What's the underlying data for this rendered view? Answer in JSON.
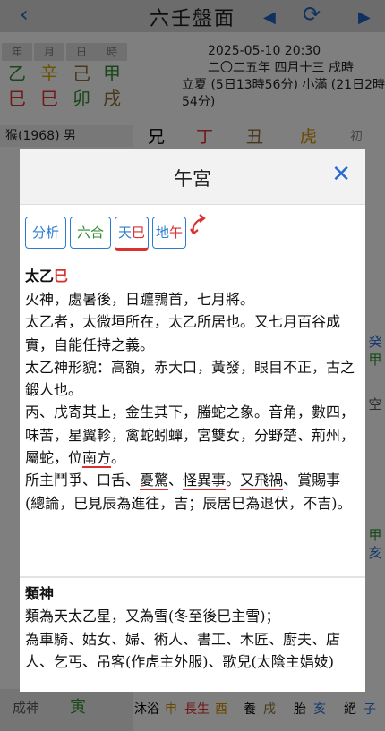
{
  "app": {
    "title": "六壬盤面"
  },
  "nav": {
    "back": "‹",
    "prev": "◀",
    "refresh": "⟳",
    "next": "▶"
  },
  "pillars": {
    "headers": [
      "年",
      "月",
      "日",
      "時"
    ],
    "stems": [
      "乙",
      "辛",
      "己",
      "甲"
    ],
    "branches": [
      "巳",
      "巳",
      "卯",
      "戌"
    ]
  },
  "date": {
    "datetime": "2025-05-10 20:30",
    "lunar": "二〇二五年 四月十三 戌時",
    "solar_terms": "立夏 (5日13時56分) 小滿 (21日2時54分)"
  },
  "person": {
    "info": "猴(1968) 男"
  },
  "top_row": [
    "兄",
    "丁",
    "丑",
    "虎",
    "初"
  ],
  "right_strip": [
    "癸",
    "甲",
    "空",
    "甲",
    "亥"
  ],
  "bottom_row": [
    "沐浴",
    "申",
    "長生",
    "酉",
    "養",
    "戌",
    "胎",
    "亥",
    "絕",
    "子"
  ],
  "bottom_left": {
    "label": "成神",
    "value": "寅"
  },
  "dialog": {
    "title": "午宮",
    "close": "✕",
    "tabs": [
      {
        "label": "分析"
      },
      {
        "label": "六合"
      },
      {
        "label_a": "天",
        "label_b": "巳"
      },
      {
        "label_a": "地",
        "label_b": "午"
      }
    ],
    "section1": {
      "heading_a": "太乙",
      "heading_b": "巳",
      "p1": "火神，處暑後，日躔鶉首，七月將。",
      "p2": "太乙者，太微垣所在，太乙所居也。又七月百谷成實，自能任持之義。",
      "p3": "太乙神形貌：高額，赤大口，黃發，眼目不正，古之鍛人也。",
      "p4a": "丙、戊寄其上，金生其下，螣蛇之象。音角，數四，味苦，星翼軫，禽蛇蚓蟬，宮雙女，分野楚、荊州，屬蛇，位",
      "p4b": "南方",
      "p4c": "。",
      "p5a": "所主鬥爭、口舌、",
      "p5b": "憂驚",
      "p5c": "、",
      "p5d": "怪異事",
      "p5e": "。",
      "p5f": "又飛禍",
      "p5g": "、賞賜事(總論，巳見辰為進往，吉；辰居巳為退伏，不吉)。"
    },
    "section2": {
      "heading": "類神",
      "p1": "類為天太乙星，又為雪(冬至後巳主雪)；",
      "p2": "為車騎、姑女、婦、術人、書工、木匠、廚夫、店人、乞丐、吊客(作虎主外服)、歌兒(太陰主娼妓)"
    }
  }
}
